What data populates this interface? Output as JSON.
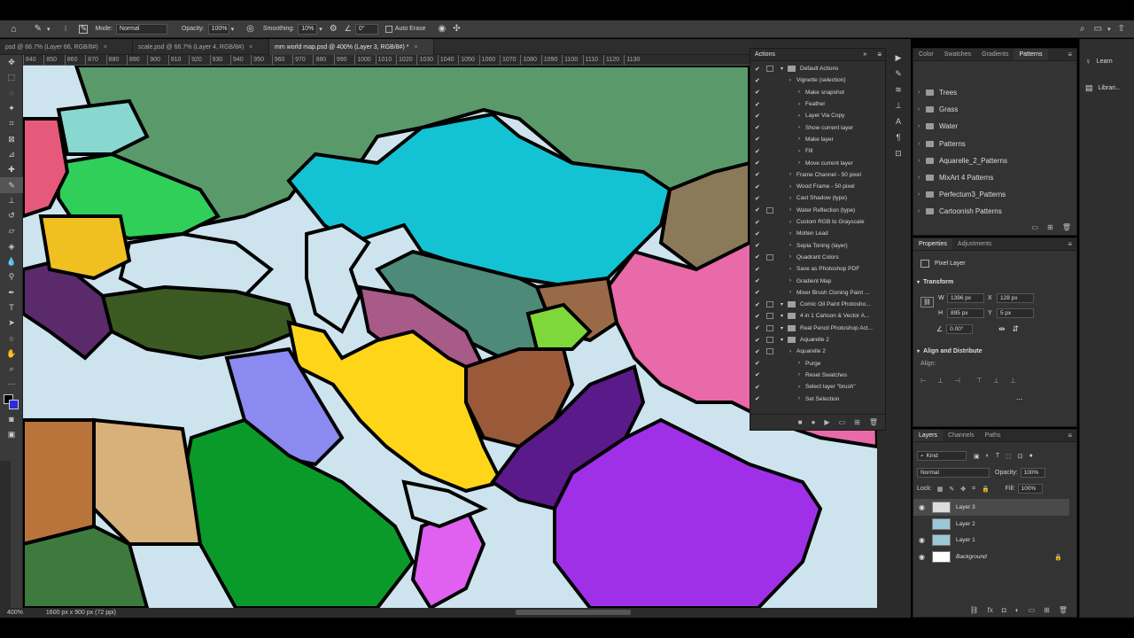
{
  "options_bar": {
    "mode_label": "Mode:",
    "mode_value": "Normal",
    "opacity_label": "Opacity:",
    "opacity_value": "100%",
    "smoothing_label": "Smoothing:",
    "smoothing_value": "10%",
    "angle_value": "0°",
    "auto_erase_label": "Auto Erase"
  },
  "tabs": [
    {
      "label": "psd @ 66.7% (Layer 66, RGB/8#)",
      "active": false
    },
    {
      "label": "scale.psd @ 66.7% (Layer 4, RGB/8#)",
      "active": false
    },
    {
      "label": "mm world map.psd @ 400% (Layer 3, RGB/8#) *",
      "active": true
    }
  ],
  "ruler_ticks": [
    "840",
    "850",
    "860",
    "870",
    "880",
    "890",
    "900",
    "910",
    "920",
    "930",
    "940",
    "950",
    "960",
    "970",
    "980",
    "990",
    "1000",
    "1010",
    "1020",
    "1030",
    "1040",
    "1050",
    "1060",
    "1070",
    "1080",
    "1090",
    "1100",
    "1110",
    "1120",
    "1130"
  ],
  "status": {
    "zoom": "400%",
    "doc_size": "1600 px x 900 px (72 ppi)"
  },
  "actions": {
    "title": "Actions",
    "rows": [
      {
        "label": "Default Actions",
        "indent": 0,
        "folder": true
      },
      {
        "label": "Vignette (selection)",
        "indent": 1,
        "folder": false
      },
      {
        "label": "Make snapshot",
        "indent": 2,
        "folder": false
      },
      {
        "label": "Feather",
        "indent": 2,
        "folder": false
      },
      {
        "label": "Layer Via Copy",
        "indent": 2,
        "folder": false
      },
      {
        "label": "Show current layer",
        "indent": 2,
        "folder": false
      },
      {
        "label": "Make layer",
        "indent": 2,
        "folder": false
      },
      {
        "label": "Fill",
        "indent": 2,
        "folder": false
      },
      {
        "label": "Move current layer",
        "indent": 2,
        "folder": false
      },
      {
        "label": "Frame Channel - 50 pixel",
        "indent": 1,
        "folder": false
      },
      {
        "label": "Wood Frame - 50 pixel",
        "indent": 1,
        "folder": false
      },
      {
        "label": "Cast Shadow (type)",
        "indent": 1,
        "folder": false
      },
      {
        "label": "Water Reflection (type)",
        "indent": 1,
        "folder": false
      },
      {
        "label": "Custom RGB to Grayscale",
        "indent": 1,
        "folder": false
      },
      {
        "label": "Molten Lead",
        "indent": 1,
        "folder": false
      },
      {
        "label": "Sepia Toning (layer)",
        "indent": 1,
        "folder": false
      },
      {
        "label": "Quadrant Colors",
        "indent": 1,
        "folder": false
      },
      {
        "label": "Save as Photoshop PDF",
        "indent": 1,
        "folder": false
      },
      {
        "label": "Gradient Map",
        "indent": 1,
        "folder": false
      },
      {
        "label": "Mixer Brush Cloning Paint ...",
        "indent": 1,
        "folder": false
      },
      {
        "label": "Comic Oil Paint Photosho...",
        "indent": 0,
        "folder": true
      },
      {
        "label": "4 in 1 Cartoon & Vector A...",
        "indent": 0,
        "folder": true
      },
      {
        "label": "Real Pencil Photoshop Act...",
        "indent": 0,
        "folder": true
      },
      {
        "label": "Aquarelle 2",
        "indent": 0,
        "folder": true
      },
      {
        "label": "Aquarelle 2",
        "indent": 1,
        "folder": false
      },
      {
        "label": "Purge",
        "indent": 2,
        "folder": false
      },
      {
        "label": "Reset Swatches",
        "indent": 2,
        "folder": false
      },
      {
        "label": "Select layer \"brush\"",
        "indent": 2,
        "folder": false
      },
      {
        "label": "Set Selection",
        "indent": 2,
        "folder": false
      }
    ]
  },
  "patterns_panel": {
    "tabs": [
      "Color",
      "Swatches",
      "Gradients",
      "Patterns"
    ],
    "active_tab": "Patterns",
    "groups": [
      "Trees",
      "Grass",
      "Water",
      "Patterns",
      "Aquarelle_2_Patterns",
      "MixArt 4 Patterns",
      "Perfectum3_Patterns",
      "Cartoonish Patterns"
    ]
  },
  "learn_panel": {
    "items": [
      "Learn",
      "Librari..."
    ]
  },
  "properties": {
    "tabs": [
      "Properties",
      "Adjustments"
    ],
    "kind": "Pixel Layer",
    "transform_label": "Transform",
    "w_label": "W",
    "w_value": "1396 px",
    "h_label": "H",
    "h_value": "895 px",
    "x_label": "X",
    "x_value": "128 px",
    "y_label": "Y",
    "y_value": "5 px",
    "angle_value": "0.00°",
    "align_label": "Align and Distribute",
    "align_sub": "Align:",
    "more": "..."
  },
  "layers_panel": {
    "tabs": [
      "Layers",
      "Channels",
      "Paths"
    ],
    "kind_label": "Kind",
    "blend_mode": "Normal",
    "opacity_label": "Opacity:",
    "opacity_value": "100%",
    "lock_label": "Lock:",
    "fill_label": "Fill:",
    "fill_value": "100%",
    "layers": [
      {
        "name": "Layer 3",
        "active": true,
        "visible": true
      },
      {
        "name": "Layer 2",
        "active": false,
        "visible": false
      },
      {
        "name": "Layer 1",
        "active": false,
        "visible": true
      },
      {
        "name": "Background",
        "active": false,
        "visible": true,
        "locked": true
      }
    ]
  },
  "colors": {
    "ui_dark": "#2b2b2b",
    "panel": "#333333",
    "ocean": "#cfe6ee",
    "foreground_swatch": "#000000",
    "background_swatch": "#2a2adf"
  }
}
